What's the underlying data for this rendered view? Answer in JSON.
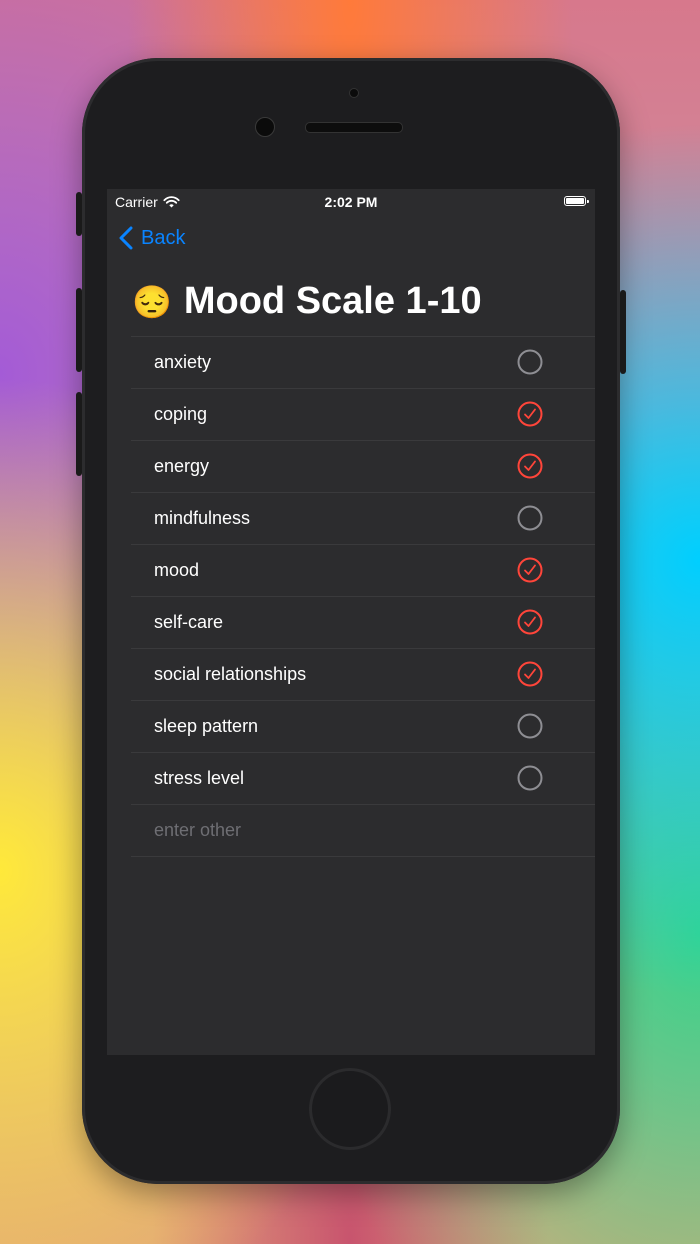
{
  "status_bar": {
    "carrier": "Carrier",
    "time": "2:02 PM"
  },
  "nav": {
    "back_label": "Back"
  },
  "header": {
    "emoji": "😔",
    "title": "Mood Scale 1-10"
  },
  "items": [
    {
      "label": "anxiety",
      "checked": false
    },
    {
      "label": "coping",
      "checked": true
    },
    {
      "label": "energy",
      "checked": true
    },
    {
      "label": "mindfulness",
      "checked": false
    },
    {
      "label": "mood",
      "checked": true
    },
    {
      "label": "self-care",
      "checked": true
    },
    {
      "label": "social relationships",
      "checked": true
    },
    {
      "label": "sleep pattern",
      "checked": false
    },
    {
      "label": "stress level",
      "checked": false
    }
  ],
  "other": {
    "placeholder": "enter other"
  },
  "colors": {
    "accent": "#0a84ff",
    "checked": "#ff453a",
    "unchecked": "#8e8e93",
    "background": "#2c2c2e"
  }
}
